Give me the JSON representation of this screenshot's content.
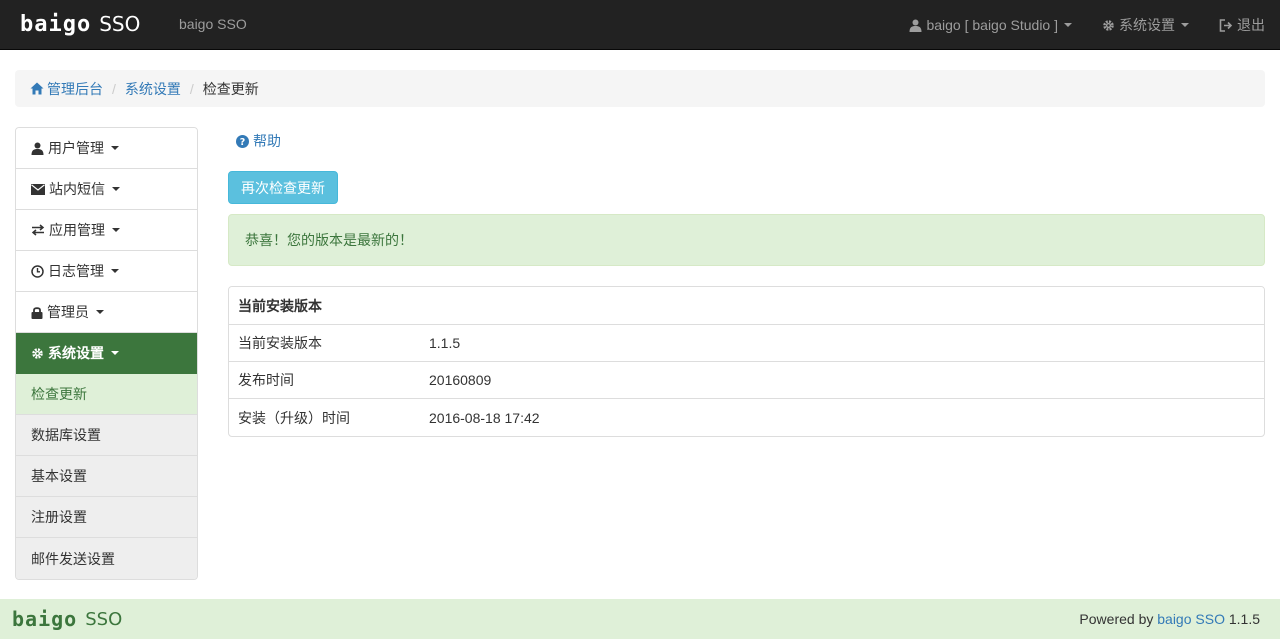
{
  "navbar": {
    "logo_text": "baigo",
    "logo_sso": "SSO",
    "app_name": "baigo SSO",
    "user_label": "baigo [ baigo Studio ]",
    "settings_label": "系统设置",
    "logout_label": "退出"
  },
  "breadcrumb": {
    "home": "管理后台",
    "section": "系统设置",
    "current": "检查更新"
  },
  "sidebar": {
    "items": [
      {
        "label": "用户管理",
        "icon": "user-icon"
      },
      {
        "label": "站内短信",
        "icon": "envelope-icon"
      },
      {
        "label": "应用管理",
        "icon": "transfer-icon"
      },
      {
        "label": "日志管理",
        "icon": "clock-icon"
      },
      {
        "label": "管理员",
        "icon": "lock-icon"
      },
      {
        "label": "系统设置",
        "icon": "gear-icon"
      }
    ],
    "subitems": [
      {
        "label": "检查更新"
      },
      {
        "label": "数据库设置"
      },
      {
        "label": "基本设置"
      },
      {
        "label": "注册设置"
      },
      {
        "label": "邮件发送设置"
      }
    ]
  },
  "main": {
    "help_label": "帮助",
    "recheck_button": "再次检查更新",
    "alert_text": "恭喜！您的版本是最新的！",
    "panel": {
      "title": "当前安装版本",
      "rows": [
        {
          "label": "当前安装版本",
          "value": "1.1.5"
        },
        {
          "label": "发布时间",
          "value": "20160809"
        },
        {
          "label": "安装（升级）时间",
          "value": "2016-08-18 17:42"
        }
      ]
    }
  },
  "footer": {
    "logo_text": "baigo",
    "logo_sso": "SSO",
    "powered_by": "Powered by",
    "powered_link": "baigo SSO",
    "version": "1.1.5"
  },
  "colors": {
    "navbar_bg": "#222222",
    "accent_green": "#3c763d",
    "success_bg": "#dff0d8",
    "info_button": "#5bc0de",
    "link": "#337ab7"
  }
}
